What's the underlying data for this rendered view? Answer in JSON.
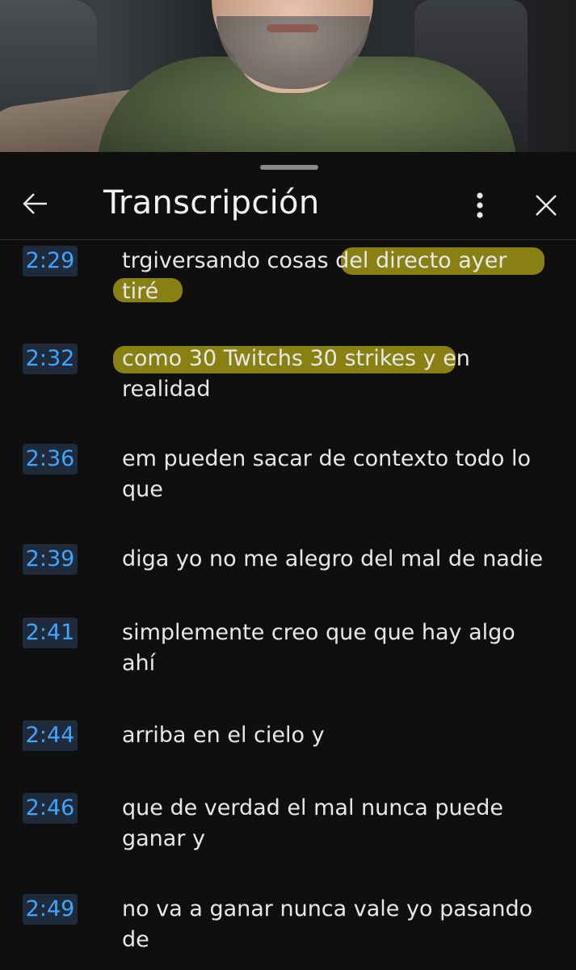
{
  "header": {
    "title": "Transcripción"
  },
  "icons": {
    "back": "arrow-back-icon",
    "more": "more-vertical-icon",
    "close": "close-icon"
  },
  "colors": {
    "background": "#0f0f0f",
    "timestamp_text": "#3ea6ff",
    "timestamp_bg": "#1f2a3a",
    "highlight": "#aaa014"
  },
  "segments": [
    {
      "time": "2:29",
      "lines": [
        "trgiversando cosas del directo ayer",
        "tiré"
      ]
    },
    {
      "time": "2:32",
      "lines": [
        "como 30 Twitchs 30 strikes y en",
        "realidad"
      ]
    },
    {
      "time": "2:36",
      "lines": [
        "em pueden sacar de contexto todo lo",
        "que"
      ]
    },
    {
      "time": "2:39",
      "lines": [
        "diga yo no me alegro del mal de nadie"
      ]
    },
    {
      "time": "2:41",
      "lines": [
        "simplemente creo que que hay algo",
        "ahí"
      ]
    },
    {
      "time": "2:44",
      "lines": [
        "arriba en el cielo y"
      ]
    },
    {
      "time": "2:46",
      "lines": [
        "que de verdad el mal nunca puede",
        "ganar y"
      ]
    },
    {
      "time": "2:49",
      "lines": [
        "no va a ganar nunca vale yo pasando",
        "de"
      ]
    }
  ]
}
